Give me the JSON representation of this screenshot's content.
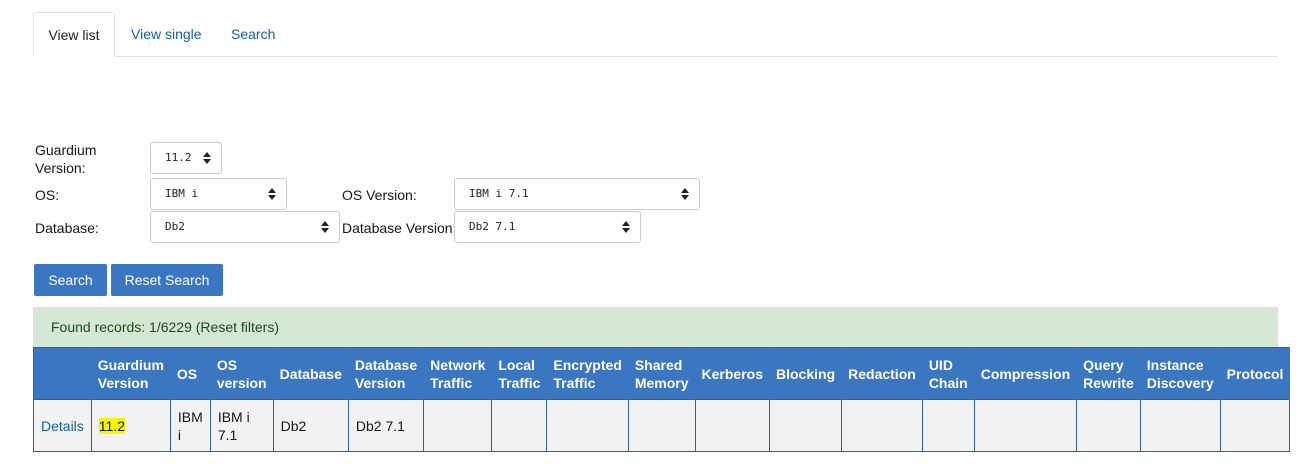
{
  "tabs": [
    {
      "label": "View list"
    },
    {
      "label": "View single"
    },
    {
      "label": "Search"
    }
  ],
  "filters": {
    "guardium_version_label": "Guardium Version:",
    "guardium_version_value": "11.2",
    "os_label": "OS:",
    "os_value": "IBM i",
    "os_version_label": "OS Version:",
    "os_version_value": "IBM i 7.1",
    "database_label": "Database:",
    "database_value": "Db2",
    "database_version_label": "Database Version:",
    "database_version_value": "Db2 7.1"
  },
  "buttons": {
    "search": "Search",
    "reset_search": "Reset Search"
  },
  "found": {
    "text": "Found records: 1/6229",
    "reset_link": "(Reset filters)"
  },
  "table": {
    "columns": [
      "",
      "Guardium Version",
      "OS",
      "OS version",
      "Database",
      "Database Version",
      "Network Traffic",
      "Local Traffic",
      "Encrypted Traffic",
      "Shared Memory",
      "Kerberos",
      "Blocking",
      "Redaction",
      "UID Chain",
      "Compression",
      "Query Rewrite",
      "Instance Discovery",
      "Protocol"
    ],
    "rows": [
      [
        "Details",
        "11.2",
        "IBM i",
        "IBM i 7.1",
        "Db2",
        "Db2 7.1",
        "",
        "",
        "",
        "",
        "",
        "",
        "",
        "",
        "",
        "",
        "",
        ""
      ]
    ]
  },
  "colors": {
    "accent": "#3a77c0",
    "link": "#0f62a8",
    "success_bg": "#d5e8d4",
    "highlight": "#f5f500"
  }
}
